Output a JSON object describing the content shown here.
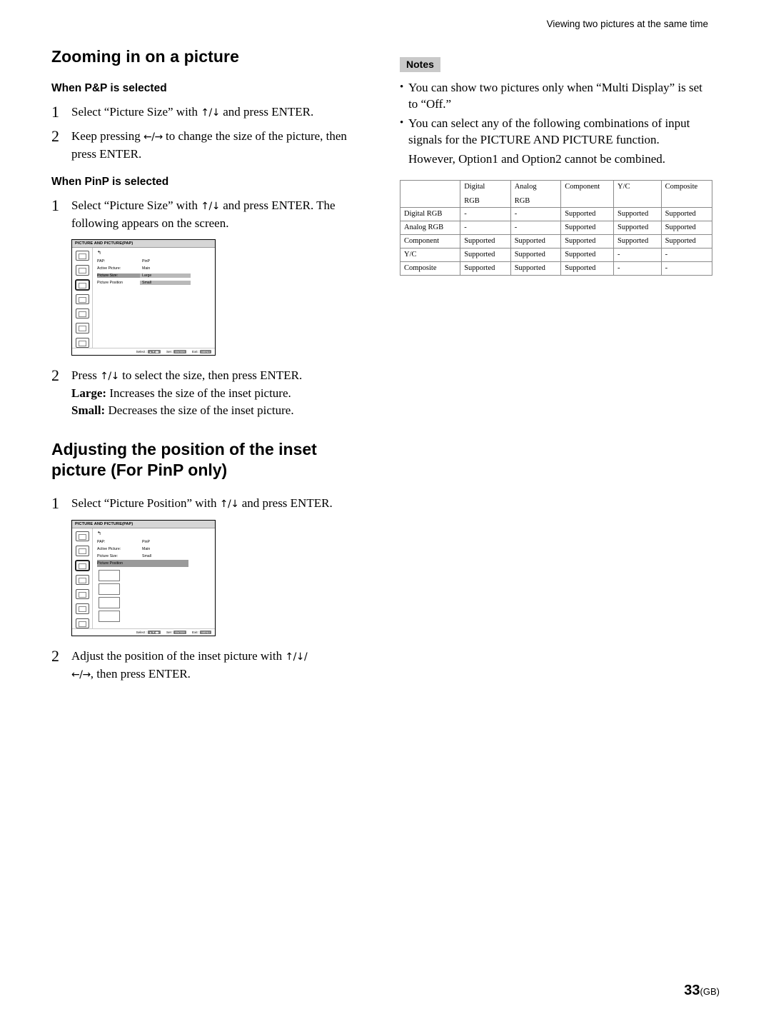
{
  "header": {
    "running_head": "Viewing two pictures at the same time"
  },
  "left": {
    "title": "Zooming in on a picture",
    "subsection_pap": "When P&P is selected",
    "steps_pap": [
      {
        "num": "1",
        "text_before": "Select “Picture Size” with ",
        "arrows": "↑/↓",
        "text_after": " and press ENTER."
      },
      {
        "num": "2",
        "text_before": "Keep pressing ",
        "arrows": "←/→",
        "text_after": " to change the size of the picture, then press ENTER."
      }
    ],
    "subsection_pinp": "When PinP is selected",
    "steps_pinp": [
      {
        "num": "1",
        "text_before": "Select “Picture Size” with ",
        "arrows": "↑/↓",
        "text_after": " and press ENTER. The following appears on the screen."
      }
    ],
    "step2_pinp": {
      "num": "2",
      "text_before": "Press ",
      "arrows": "↑/↓",
      "text_after": " to select the size, then press ENTER.",
      "large_label": "Large:",
      "large_text": " Increases the size of the inset picture.",
      "small_label": "Small:",
      "small_text": " Decreases the size of the inset picture."
    },
    "title2": "Adjusting the position of the inset picture (For PinP only)",
    "steps_pos": [
      {
        "num": "1",
        "text_before": "Select “Picture Position” with ",
        "arrows": "↑/↓",
        "text_after": " and press ENTER."
      }
    ],
    "step2_pos": {
      "num": "2",
      "text_before": "Adjust the position of the inset picture with ",
      "arrows": "↑/↓/",
      "arrows2": "←/→",
      "text_after": ", then press ENTER."
    }
  },
  "osd1": {
    "title": "PICTURE AND PICTURE(PAP)",
    "back_glyph": "↰",
    "rows": [
      {
        "label": "PAP:",
        "value": "PinP",
        "highlight": false
      },
      {
        "label": "Active Picture:",
        "value": "Main",
        "highlight": false
      },
      {
        "label": "Picture Size:",
        "value": "Large",
        "highlight": true
      },
      {
        "label": "Picture Position",
        "value": "Small",
        "highlight": "value-only"
      }
    ],
    "footer": {
      "select_label": "Select :",
      "set_label": "Set :",
      "set_key": "ENTER",
      "exit_label": "Exit :",
      "exit_key": "MENU"
    }
  },
  "osd2": {
    "title": "PICTURE AND PICTURE(PAP)",
    "back_glyph": "↰",
    "rows": [
      {
        "label": "PAP:",
        "value": "PinP",
        "highlight": false
      },
      {
        "label": "Active Picture:",
        "value": "Main",
        "highlight": false
      },
      {
        "label": "Picture Size:",
        "value": "Small",
        "highlight": false
      },
      {
        "label": "Picture Position",
        "value": "",
        "highlight": true
      }
    ],
    "footer": {
      "select_label": "Select :",
      "set_label": "Set :",
      "set_key": "ENTER",
      "exit_label": "Exit :",
      "exit_key": "MENU"
    }
  },
  "right": {
    "notes_badge": "Notes",
    "notes": [
      "You can show two pictures only when “Multi Display” is set to “Off.”",
      "You can select any of the following combinations of input signals for the PICTURE AND PICTURE function."
    ],
    "note_extra": "However, Option1 and Option2 cannot be combined."
  },
  "table": {
    "headers": [
      "",
      "Digital",
      "Analog",
      "Component",
      "Y/C",
      "Composite"
    ],
    "subheaders": [
      "",
      "RGB",
      "RGB",
      "",
      "",
      ""
    ],
    "rows": [
      {
        "label": "Digital RGB",
        "cells": [
          "-",
          "-",
          "Supported",
          "Supported",
          "Supported"
        ]
      },
      {
        "label": "Analog RGB",
        "cells": [
          "-",
          "-",
          "Supported",
          "Supported",
          "Supported"
        ]
      },
      {
        "label": "Component",
        "cells": [
          "Supported",
          "Supported",
          "Supported",
          "Supported",
          "Supported"
        ]
      },
      {
        "label": "Y/C",
        "cells": [
          "Supported",
          "Supported",
          "Supported",
          "-",
          "-"
        ]
      },
      {
        "label": "Composite",
        "cells": [
          "Supported",
          "Supported",
          "Supported",
          "-",
          "-"
        ]
      }
    ]
  },
  "footer": {
    "page_number": "33",
    "page_suffix": "(GB)"
  }
}
